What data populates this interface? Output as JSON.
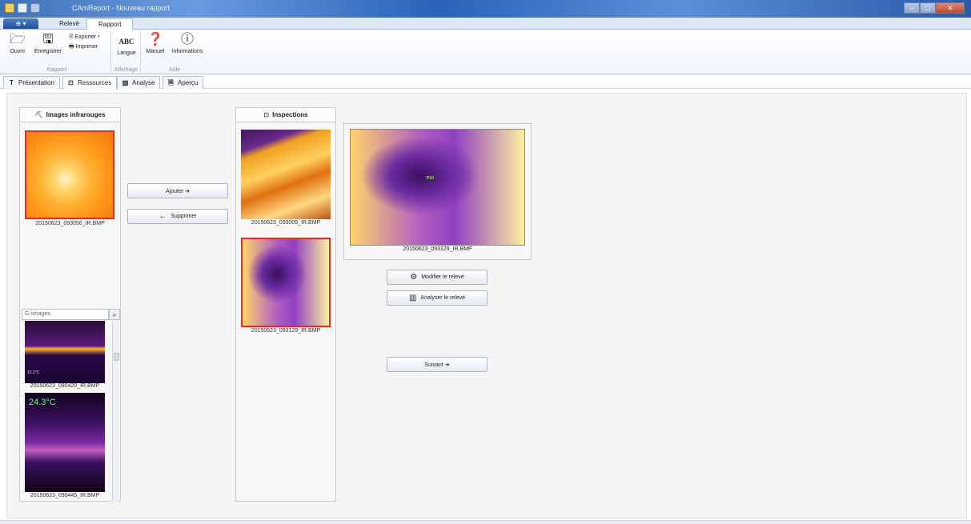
{
  "window": {
    "title": "CAmReport - Nouveau rapport"
  },
  "ribbon_tabs": [
    {
      "label": "Relevé"
    },
    {
      "label": "Rapport"
    }
  ],
  "ribbon": {
    "open_label": "Ouvrir",
    "save_label": "Enregistrer",
    "export_label": "Exporter",
    "print_label": "Imprimer",
    "group_rapport": "Rapport",
    "abc_label": "ABC",
    "language_label": "Langue",
    "group_affichage": "Affichage",
    "manual_label": "Manuel",
    "info_label": "Informations",
    "group_aide": "Aide"
  },
  "page_tabs": [
    {
      "label": "Présentation"
    },
    {
      "label": "Ressources"
    },
    {
      "label": "Analyse"
    },
    {
      "label": "Aperçu"
    }
  ],
  "infrared_panel": {
    "title": "Images infrarouges",
    "selected_caption": "20150623_093056_IR.BMP",
    "path": "G:\\images",
    "browser_items": [
      {
        "caption": "20150623_090420_IR.BMP",
        "overlay": "13.2°C"
      },
      {
        "caption": "20150623_090445_IR.BMP",
        "overlay": "24.3°C"
      }
    ]
  },
  "actions": {
    "add_label": "Ajouter ➔",
    "remove_label": "Supprimer"
  },
  "inspections_panel": {
    "title": "Inspections",
    "items": [
      {
        "caption": "20150623_093009_IR.BMP"
      },
      {
        "caption": "20150623_093129_IR.BMP"
      }
    ]
  },
  "preview": {
    "caption": "20150623_093129_IR.BMP",
    "overlay": "P10",
    "modify_label": "Modifier le relevé",
    "analyze_label": "Analyser le relevé",
    "next_label": "Suivant ➔"
  },
  "colors": {
    "accent": "#2a63b8",
    "selection": "#e03020"
  }
}
